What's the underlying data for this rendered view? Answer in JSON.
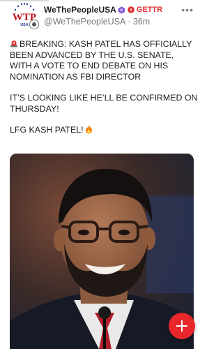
{
  "post": {
    "author": {
      "display_name": "WeThePeopleUSA",
      "handle": "@WeThePeopleUSA",
      "time": "36m",
      "source": "GETTR",
      "avatar_text": "WTP",
      "avatar_subtext": "USA"
    },
    "text": {
      "line1_text": "BREAKING: KASH PATEL HAS OFFICIALLY BEEN ADVANCED BY THE U.S. SENATE, WITH A VOTE TO END DEBATE ON HIS NOMINATION AS FBI DIRECTOR",
      "line2": "IT’S LOOKING LIKE HE’LL BE CONFIRMED ON THURSDAY!",
      "line3": "LFG KASH PATEL!"
    },
    "media": {
      "kind": "photo"
    }
  },
  "icons": {
    "more": "more-options-icon",
    "fab": "add-post-icon",
    "siren": "siren-emoji-icon",
    "fire": "fire-emoji-icon",
    "verified": "verified-badge-icon",
    "gettr": "gettr-logo-icon"
  },
  "colors": {
    "brand_red": "#e0302e",
    "verified_purple": "#7b4bd6",
    "fab_red": "#e8262b"
  }
}
